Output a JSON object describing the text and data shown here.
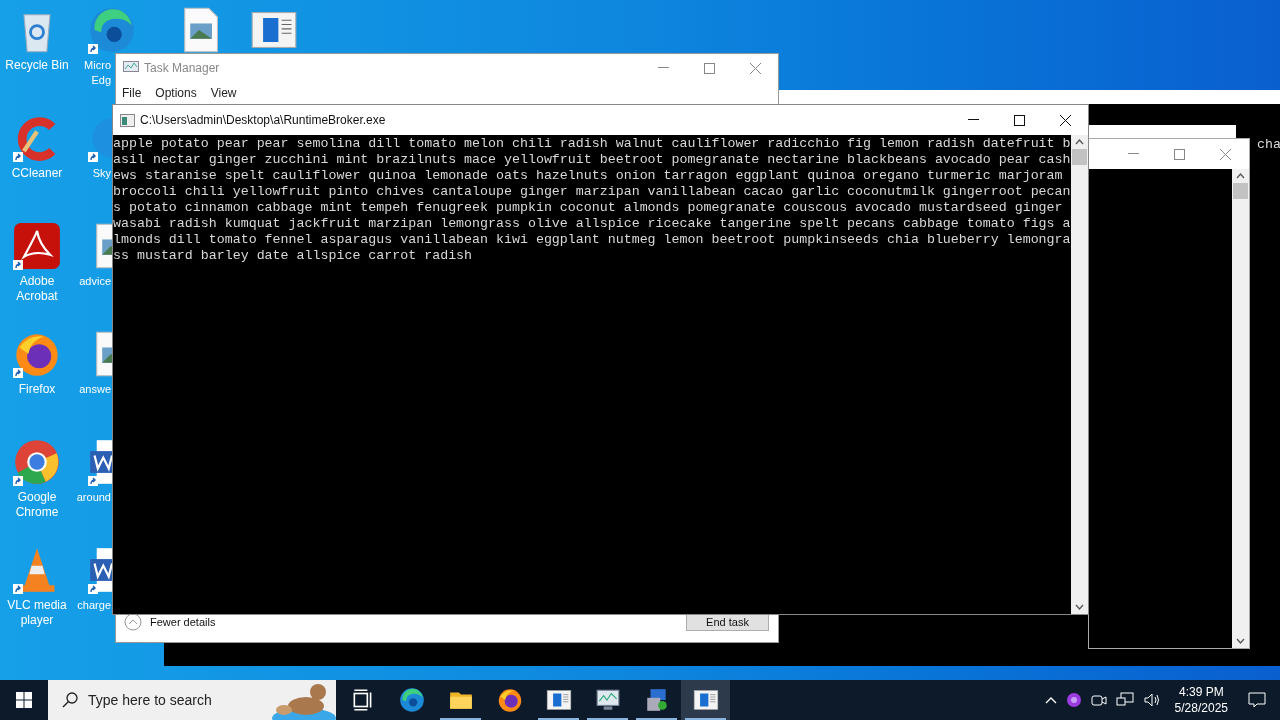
{
  "desktop": {
    "columns": [
      {
        "icons": [
          {
            "kind": "recycle",
            "label": "Recycle Bin"
          },
          {
            "kind": "ccleaner",
            "label": "CCleaner"
          },
          {
            "kind": "acrobat",
            "label": "Adobe Acrobat"
          },
          {
            "kind": "firefox",
            "label": "Firefox"
          },
          {
            "kind": "chrome",
            "label": "Google Chrome"
          },
          {
            "kind": "vlc",
            "label": "VLC media player"
          }
        ]
      },
      {
        "icons": [
          {
            "kind": "edge",
            "label": "Micro",
            "label2": "Edg"
          },
          {
            "kind": "skype",
            "label": "Sky"
          },
          {
            "kind": "image",
            "label": "advice"
          },
          {
            "kind": "image",
            "label": "answe"
          },
          {
            "kind": "word",
            "label": "around"
          },
          {
            "kind": "word",
            "label": "charge"
          }
        ]
      },
      {
        "icons": [
          {
            "kind": "image"
          }
        ]
      },
      {
        "icons": [
          {
            "kind": "window"
          }
        ]
      }
    ]
  },
  "background_console": {
    "text": "cha"
  },
  "task_manager": {
    "title": "Task Manager",
    "menu": [
      "File",
      "Options",
      "View"
    ],
    "toggle": "Fewer details",
    "button": "End task"
  },
  "console": {
    "title": "C:\\Users\\admin\\Desktop\\a\\RuntimeBroker.exe",
    "lines": [
      "apple potato pear pear semolina dill tomato melon chili radish walnut cauliflower radicchio fig lemon radish datefruit b",
      "asil nectar ginger zucchini mint brazilnuts mace yellowfruit beetroot pomegranate nectarine blackbeans avocado pear cash",
      "ews staranise spelt cauliflower quinoa lemonade oats hazelnuts onion tarragon eggplant quinoa oregano turmeric marjoram",
      "broccoli chili yellowfruit pinto chives cantaloupe ginger marzipan vanillabean cacao garlic coconutmilk gingerroot pecan",
      "s potato cinnamon cabbage mint tempeh fenugreek pumpkin coconut almonds pomegranate couscous avocado mustardseed ginger",
      "wasabi radish kumquat jackfruit marzipan lemongrass olive allspice ricecake tangerine spelt pecans cabbage tomato figs a",
      "lmonds dill tomato fennel asparagus vanillabean kiwi eggplant nutmeg lemon beetroot pumpkinseeds chia blueberry lemongra",
      "ss mustard barley date allspice carrot radish"
    ]
  },
  "taskbar": {
    "search_placeholder": "Type here to search",
    "apps": [
      {
        "kind": "taskview",
        "running": false,
        "selected": false
      },
      {
        "kind": "edge",
        "running": false,
        "selected": false
      },
      {
        "kind": "folder",
        "running": true,
        "selected": false
      },
      {
        "kind": "firefox",
        "running": false,
        "selected": false
      },
      {
        "kind": "window",
        "running": true,
        "selected": false
      },
      {
        "kind": "monitor",
        "running": true,
        "selected": false
      },
      {
        "kind": "installer",
        "running": true,
        "selected": false
      },
      {
        "kind": "window",
        "running": true,
        "selected": true
      }
    ],
    "time": "4:39 PM",
    "date": "5/28/2025"
  }
}
